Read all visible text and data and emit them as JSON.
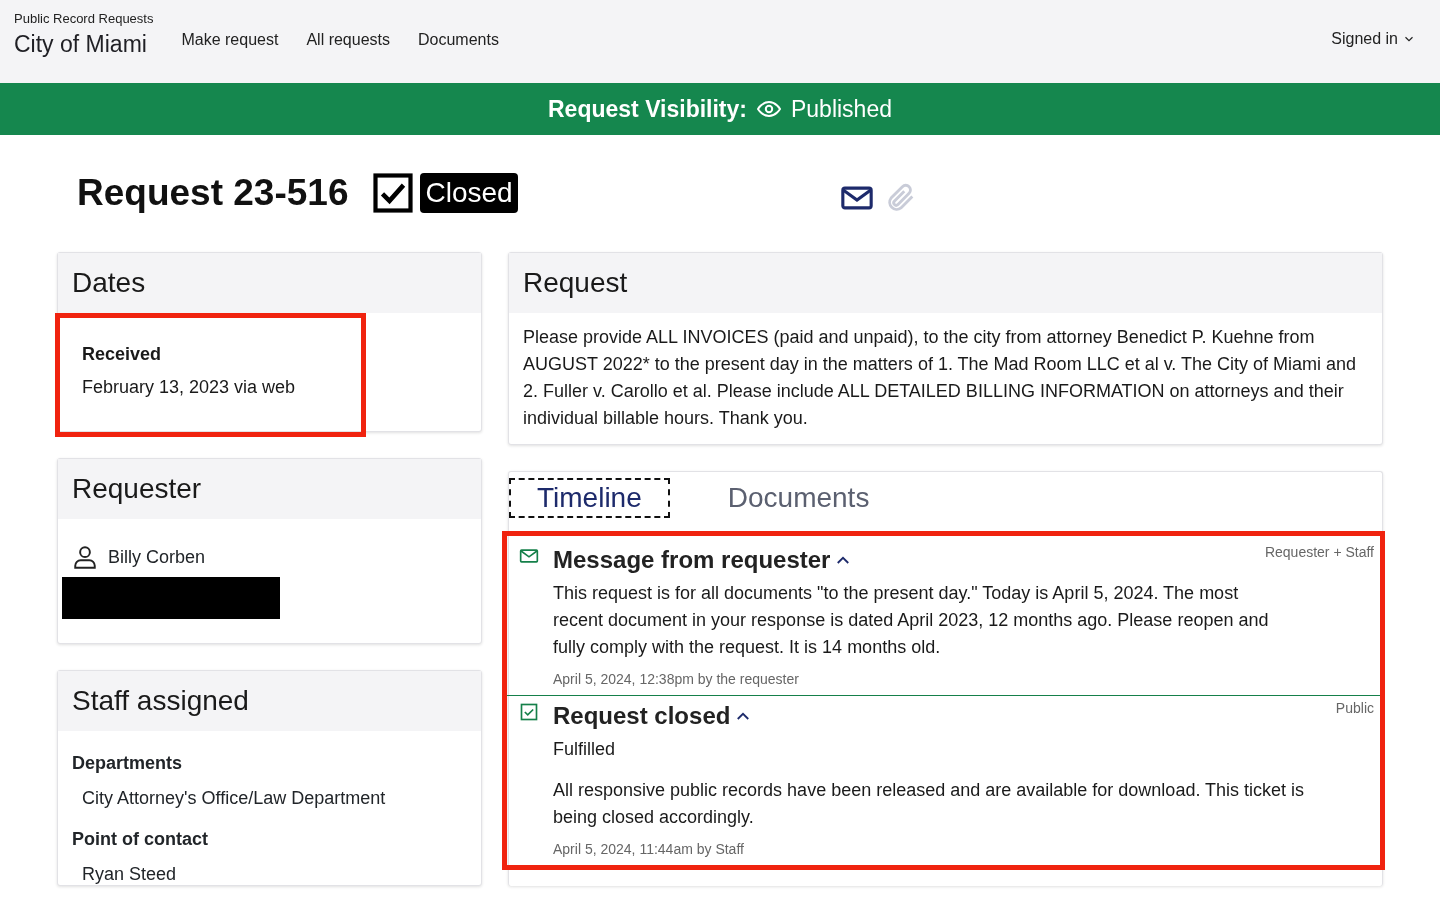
{
  "header": {
    "portal": "Public Record Requests",
    "city": "City of Miami",
    "nav": [
      "Make request",
      "All requests",
      "Documents"
    ],
    "account": "Signed in"
  },
  "visibility": {
    "label": "Request Visibility:",
    "value": "Published"
  },
  "request_title": "Request 23-516",
  "status": {
    "label": "Closed",
    "closed": true
  },
  "dates": {
    "title": "Dates",
    "highlighted": true,
    "label": "Received",
    "value": "February 13, 2023 via web"
  },
  "requester": {
    "title": "Requester",
    "name": "Billy Corben",
    "redacted": true
  },
  "staff": {
    "title": "Staff assigned",
    "departments_label": "Departments",
    "departments": "City Attorney's Office/Law Department",
    "contact_label": "Point of contact",
    "contact": "Ryan Steed"
  },
  "request": {
    "title": "Request",
    "text": "Please provide ALL INVOICES (paid and unpaid), to the city from attorney Benedict P. Kuehne from AUGUST 2022* to the present day in the matters of 1. The Mad Room LLC et al v. The City of Miami and 2. Fuller v. Carollo et al. Please include ALL DETAILED BILLING INFORMATION on attorneys and their individual billable hours. Thank you."
  },
  "tabs": [
    {
      "label": "Timeline",
      "selected": true
    },
    {
      "label": "Documents",
      "selected": false
    }
  ],
  "timeline": {
    "highlighted": true,
    "events": [
      {
        "kind": "message",
        "title": "Message from requester",
        "expanded": true,
        "visibility": "Requester + Staff",
        "paragraphs": [
          "This request is for all documents \"to the present day.\" Today is April 5, 2024. The most recent document in your response is dated April 2023, 12 months ago. Please reopen and fully comply with the request. It is 14 months old."
        ],
        "meta": "April 5, 2024, 12:38pm by the requester"
      },
      {
        "kind": "closed",
        "title": "Request closed",
        "expanded": true,
        "visibility": "Public",
        "paragraphs": [
          "Fulfilled",
          "All responsive public records have been released and are available for download. This ticket is being closed accordingly."
        ],
        "meta": "April 5, 2024, 11:44am by Staff"
      }
    ]
  }
}
